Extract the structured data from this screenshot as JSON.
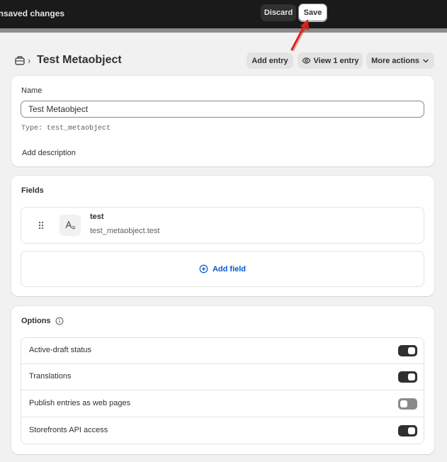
{
  "contextual_save_bar": {
    "message": "Unsaved changes",
    "discard_label": "Discard",
    "save_label": "Save"
  },
  "header": {
    "breadcrumb_icon": "metaobject-icon",
    "title": "Test Metaobject",
    "add_entry_label": "Add entry",
    "view_entries_label": "View 1 entry",
    "more_actions_label": "More actions"
  },
  "name_card": {
    "label": "Name",
    "value": "Test Metaobject",
    "type_hint": "Type: test_metaobject",
    "add_description_label": "Add description"
  },
  "fields_card": {
    "title": "Fields",
    "fields": [
      {
        "name": "test",
        "key": "test_metaobject.test",
        "icon": "text-field-icon"
      }
    ],
    "add_field_label": "Add field"
  },
  "options_card": {
    "title": "Options",
    "options": [
      {
        "label": "Active-draft status",
        "enabled": true
      },
      {
        "label": "Translations",
        "enabled": true
      },
      {
        "label": "Publish entries as web pages",
        "enabled": false
      },
      {
        "label": "Storefronts API access",
        "enabled": true
      }
    ]
  },
  "colors": {
    "topbar": "#1a1a1a",
    "accent_link": "#005bd3",
    "annotation_arrow": "#e0201b",
    "toggle_on": "#303030",
    "toggle_off": "#8a8a8a"
  }
}
